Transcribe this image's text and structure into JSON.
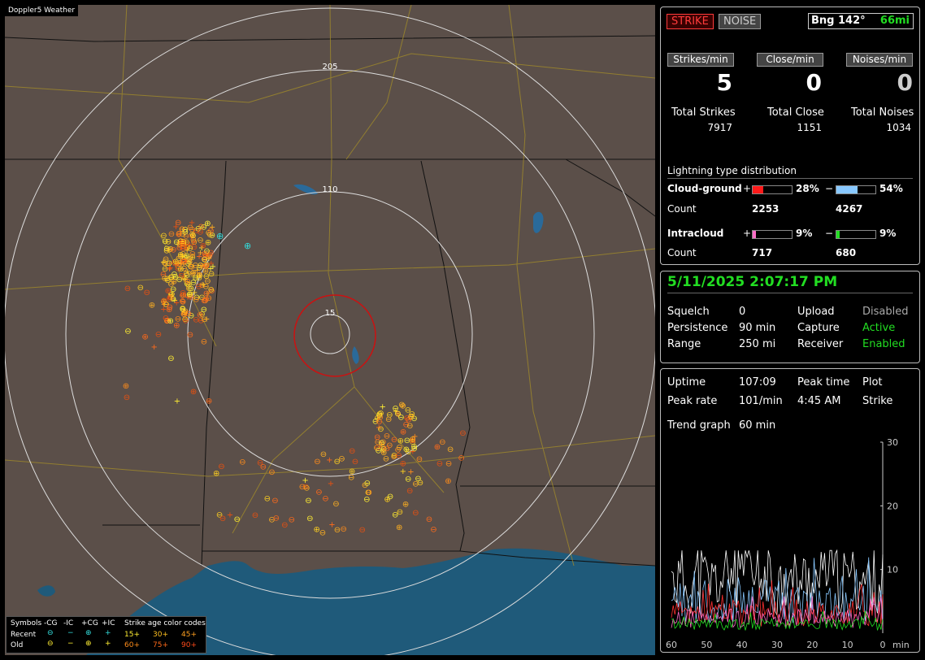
{
  "map": {
    "title": "Doppler5 Weather",
    "ring_labels": [
      "205",
      "110",
      "15"
    ],
    "legend": {
      "symbols_label": "Symbols",
      "col_headers": [
        "-CG",
        "-IC",
        "+CG",
        "+IC"
      ],
      "age_title": "Strike age color codes",
      "rows": [
        {
          "label": "Recent",
          "ages": [
            "15+",
            "30+",
            "45+"
          ]
        },
        {
          "label": "Old",
          "ages": [
            "60+",
            "75+",
            "90+"
          ]
        }
      ]
    }
  },
  "status": {
    "strike_btn": "STRIKE",
    "noise_btn": "NOISE",
    "bearing": "Bng 142°",
    "distance": "66mi",
    "rate_headers": [
      "Strikes/min",
      "Close/min",
      "Noises/min"
    ],
    "rates": [
      "5",
      "0",
      "0"
    ],
    "total_labels": [
      "Total Strikes",
      "Total Close",
      "Total Noises"
    ],
    "totals": [
      "7917",
      "1151",
      "1034"
    ],
    "dist_title": "Lightning type distribution",
    "cloud_ground": {
      "label": "Cloud-ground",
      "pos_pct": "28%",
      "neg_pct": "54%",
      "pos_count": "2253",
      "neg_count": "4267",
      "pos_fill": 0.28,
      "neg_fill": 0.54
    },
    "intracloud": {
      "label": "Intracloud",
      "pos_pct": "9%",
      "neg_pct": "9%",
      "pos_count": "717",
      "neg_count": "680",
      "pos_fill": 0.09,
      "neg_fill": 0.09
    },
    "count_label": "Count",
    "plus": "+",
    "minus": "−"
  },
  "info": {
    "datetime": "5/11/2025 2:07:17 PM",
    "rows": [
      {
        "k1": "Squelch",
        "v1": "0",
        "k2": "Upload",
        "v2": "Disabled"
      },
      {
        "k1": "Persistence",
        "v1": "90 min",
        "k2": "Capture",
        "v2": "Active"
      },
      {
        "k1": "Range",
        "v1": "250 mi",
        "k2": "Receiver",
        "v2": "Enabled"
      }
    ]
  },
  "trend": {
    "uptime_label": "Uptime",
    "uptime": "107:09",
    "peak_time_label": "Peak time",
    "peak_time": "4:45 AM",
    "plot_label": "Plot",
    "plot": "Strike",
    "peak_rate_label": "Peak rate",
    "peak_rate": "101/min",
    "graph_label": "Trend graph",
    "graph": "60 min",
    "y_ticks": [
      "30",
      "20",
      "10"
    ],
    "x_ticks": [
      "60",
      "50",
      "40",
      "30",
      "20",
      "10",
      "0"
    ],
    "x_unit": "min"
  },
  "colors": {
    "strike_red": "#ff3b3b",
    "ok_green": "#22dd22",
    "neg_blue": "#88c8ff",
    "ic_pos": "#ff6fc8",
    "ic_neg": "#22dd22",
    "land": "#5b4f49",
    "water": "#1f5a7a"
  }
}
